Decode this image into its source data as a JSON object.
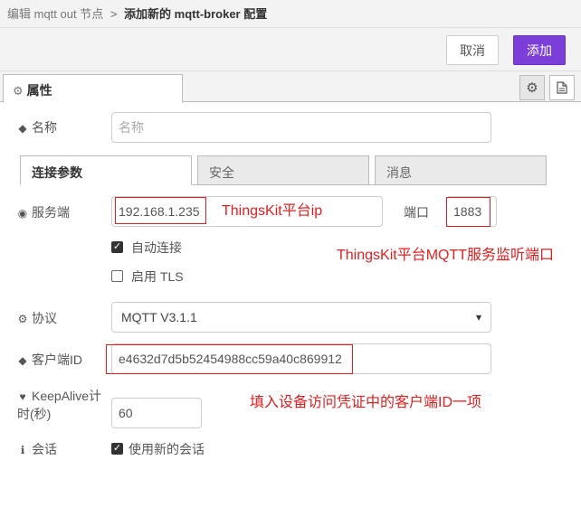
{
  "breadcrumb": {
    "previous": "编辑 mqtt out 节点",
    "separator": ">",
    "current": "添加新的 mqtt-broker 配置"
  },
  "actions": {
    "cancel_label": "取消",
    "add_label": "添加",
    "add_color": "#7b3ed8"
  },
  "tabs": {
    "properties_label": "属性",
    "properties_icon": "gear-icon",
    "settings_icon": "gear-icon",
    "description_icon": "document-icon"
  },
  "form": {
    "name": {
      "label": "名称",
      "icon": "tag-icon",
      "placeholder": "名称",
      "value": ""
    },
    "subtabs": [
      {
        "label": "连接参数",
        "active": true
      },
      {
        "label": "安全",
        "active": false
      },
      {
        "label": "消息",
        "active": false
      }
    ],
    "server": {
      "label": "服务端",
      "icon": "globe-icon",
      "value": "192.168.1.235"
    },
    "port": {
      "label": "端口",
      "value": "1883"
    },
    "auto_connect": {
      "label": "自动连接",
      "checked": true
    },
    "use_tls": {
      "label": "启用 TLS",
      "checked": false
    },
    "protocol": {
      "label": "协议",
      "icon": "cog-icon",
      "value": "MQTT V3.1.1"
    },
    "client_id": {
      "label": "客户端ID",
      "icon": "tag-icon",
      "value": "e4632d7d5b52454988cc59a40c869912"
    },
    "keepalive": {
      "label_line1": "KeepAlive计",
      "label_line2": "时(秒)",
      "icon": "heartbeat-icon",
      "value": "60"
    },
    "session": {
      "label": "会话",
      "icon": "info-icon",
      "checkbox_label": "使用新的会话",
      "checked": true
    }
  },
  "annotations": {
    "server_note": "ThingsKit平台ip",
    "port_note": "ThingsKit平台MQTT服务监听端口",
    "client_note": "填入设备访问凭证中的客户端ID一项",
    "color": "#e02020"
  }
}
